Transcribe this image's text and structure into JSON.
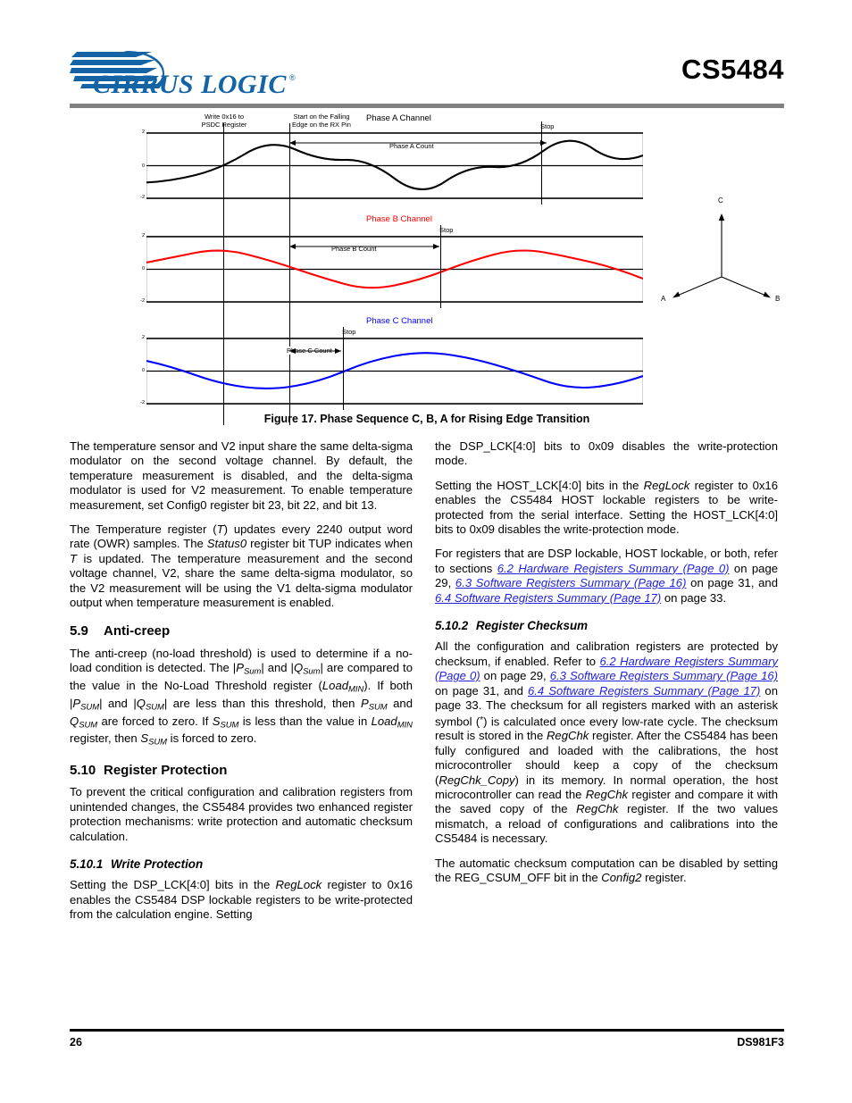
{
  "header": {
    "brand": "CIRRUS LOGIC",
    "brand_mark": "®",
    "part_number": "CS5484"
  },
  "figure": {
    "caption": "Figure 17.  Phase Sequence C, B, A for Rising Edge Transition",
    "annotations": {
      "write_psdc_l1": "Write 0x16 to",
      "write_psdc_l2": "PSDC Register",
      "start_falling_l1": "Start on the Falling",
      "start_falling_l2": "Edge on the RX Pin"
    },
    "channels": [
      {
        "title": "Phase A Channel",
        "count_label": "Phase A Count",
        "stop_label": "Stop",
        "color": "#000000",
        "y_ticks": [
          "2",
          "0",
          "-2"
        ]
      },
      {
        "title": "Phase B Channel",
        "count_label": "Phase B Count",
        "stop_label": "Stop",
        "color": "#ff0000",
        "y_ticks": [
          "2",
          "0",
          "-2"
        ]
      },
      {
        "title": "Phase C Channel",
        "count_label": "Phase C Count",
        "stop_label": "Stop",
        "color": "#0000ff",
        "y_ticks": [
          "2",
          "0",
          "-2"
        ]
      }
    ],
    "phasor": {
      "labels": {
        "a": "A",
        "b": "B",
        "c": "C"
      }
    }
  },
  "left_column": {
    "para_temp_sensor": "The temperature sensor and V2 input share the same delta-sigma modulator on the second voltage channel. By default, the temperature measurement is disabled, and the delta-sigma modulator is used for V2 measurement. To enable temperature measurement, set Config0 register bit 23, bit 22, and bit 13.",
    "para_temp_register_pre": "The Temperature register (",
    "para_temp_register_t1": "T",
    "para_temp_register_mid1": ") updates every 2240 output word rate (OWR) samples. The ",
    "para_temp_register_status0": "Status0",
    "para_temp_register_mid2": " register bit TUP indicates when ",
    "para_temp_register_t2": "T",
    "para_temp_register_end": " is updated. The temperature measurement and the second voltage channel, V2, share the same delta-sigma modulator, so the V2 measurement will be using the V1 delta-sigma modulator output when temperature measurement is enabled.",
    "sec_59_num": "5.9",
    "sec_59_title": "Anti-creep",
    "anticreep_t1": "The anti-creep (no-load threshold) is used to determine if a no-load condition is detected. The |",
    "anticreep_p1": "P",
    "anticreep_p1sub": "Sum",
    "anticreep_t2": "| and |",
    "anticreep_q1": "Q",
    "anticreep_q1sub": "Sum",
    "anticreep_t3": "| are compared to the value in the No-Load Threshold register (",
    "anticreep_load1": "Load",
    "anticreep_load1sub": "MIN",
    "anticreep_t4": "). If both |",
    "anticreep_p2": "P",
    "anticreep_p2sub": "SUM",
    "anticreep_t5": "| and |",
    "anticreep_q2": "Q",
    "anticreep_q2sub": "SUM",
    "anticreep_t6": "| are less than this threshold, then ",
    "anticreep_p3": "P",
    "anticreep_p3sub": "SUM",
    "anticreep_t7": " and ",
    "anticreep_q3": "Q",
    "anticreep_q3sub": "SUM",
    "anticreep_t8": " are forced to zero.   If ",
    "anticreep_s1": "S",
    "anticreep_s1sub": "SUM",
    "anticreep_t9": " is less than the value in ",
    "anticreep_load2": "Load",
    "anticreep_load2sub": "MIN",
    "anticreep_t10": " register, then ",
    "anticreep_s2": "S",
    "anticreep_s2sub": "SUM",
    "anticreep_t11": " is forced to zero.",
    "sec_510_num": "5.10",
    "sec_510_title": "Register Protection",
    "para_register_protection": "To prevent the critical configuration and calibration registers from unintended changes, the CS5484 provides two enhanced register protection mechanisms: write protection and automatic checksum calculation.",
    "sec_5101_num": "5.10.1",
    "sec_5101_title": "Write Protection",
    "wp_t1": "Setting the DSP_LCK[4:0] bits in the ",
    "wp_reglock": "RegLock",
    "wp_t2": " register to 0x16 enables the CS5484 DSP lockable registers to be write-protected from the calculation engine. Setting"
  },
  "right_column": {
    "cont_t1": "the DSP_LCK[4:0] bits to 0x09 disables the write-protection mode.",
    "host_t1": "Setting the HOST_LCK[4:0] bits in the ",
    "host_reglock": "RegLock",
    "host_t2": " register to 0x16 enables the CS5484 HOST lockable registers to be write-protected from the serial interface. Setting the HOST_LCK[4:0] bits to 0x09 disables the write-protection mode.",
    "refs_t1": "For registers that are DSP lockable, HOST lockable, or both, refer to sections ",
    "refs_link1": "6.2 Hardware Registers Summary (Page 0)",
    "refs_t2": " on page 29, ",
    "refs_link2": "6.3 Software Registers Summary (Page 16)",
    "refs_t3": " on page 31, and ",
    "refs_link3": "6.4 Software Registers Summary (Page 17)",
    "refs_t4": " on page 33.",
    "sec_5102_num": "5.10.2",
    "sec_5102_title": "Register Checksum",
    "cs_t1": "All the configuration and calibration registers are protected by checksum, if enabled. Refer to ",
    "cs_link1": "6.2 Hardware Registers Summary (Page 0)",
    "cs_t2": " on page 29, ",
    "cs_link2": "6.3 Software Registers Summary (Page 16)",
    "cs_t3": " on page 31, and ",
    "cs_link3": "6.4 Software Registers Summary (Page 17)",
    "cs_t4": " on page 33. The checksum for all registers marked with an asterisk symbol (",
    "cs_asterisk": "*",
    "cs_t5": ") is calculated once every low-rate cycle. The checksum result is stored in the ",
    "cs_regchk1": "RegChk",
    "cs_t6": " register. After the CS5484 has been fully configured and loaded with the calibrations, the host microcontroller should keep a copy of the checksum (",
    "cs_regchkcopy": "RegChk_Copy",
    "cs_t7": ") in its memory. In normal operation, the host microcontroller can read the ",
    "cs_regchk2": "RegChk",
    "cs_t8": " register and compare it with the saved copy of the ",
    "cs_regchk3": "RegChk",
    "cs_t9": " register. If the two values mismatch, a reload of configurations and calibrations into the CS5484 is necessary.",
    "auto_t1": "The automatic checksum computation can be disabled by setting the REG_CSUM_OFF bit in the ",
    "auto_config2": "Config2",
    "auto_t2": " register."
  },
  "footer": {
    "page_number": "26",
    "document_id": "DS981F3"
  }
}
